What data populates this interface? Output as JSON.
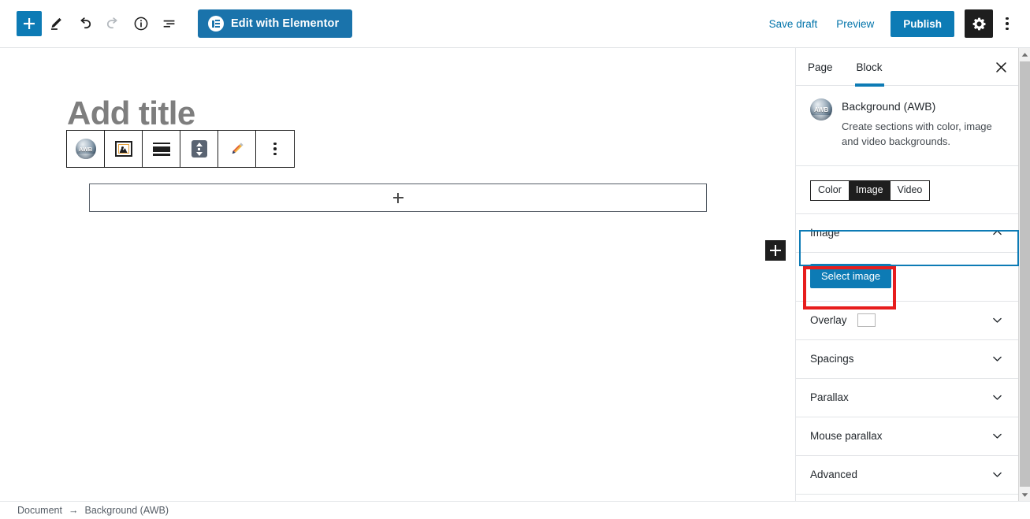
{
  "topbar": {
    "add_block_icon": "plus-icon",
    "edit_icon": "pencil-icon",
    "undo_icon": "undo-arrow-icon",
    "redo_icon": "redo-arrow-icon",
    "info_icon": "info-circle-icon",
    "list_view_icon": "list-view-icon",
    "elementor_label": "Edit with Elementor",
    "elementor_icon": "elementor-logo-icon",
    "save_draft_label": "Save draft",
    "preview_label": "Preview",
    "publish_label": "Publish",
    "settings_icon": "gear-icon",
    "more_icon": "kebab-menu-icon"
  },
  "canvas": {
    "title_placeholder": "Add title",
    "block_toolbar": {
      "items": [
        {
          "name": "awb-block-icon",
          "label": "Background (AWB)"
        },
        {
          "name": "image-icon",
          "label": "Image"
        },
        {
          "name": "align-full-width-icon",
          "label": "Full width"
        },
        {
          "name": "move-vertical-icon",
          "label": "Move up or down"
        },
        {
          "name": "edit-pencil-icon",
          "label": "Edit"
        },
        {
          "name": "block-options-kebab-icon",
          "label": "More options"
        }
      ]
    },
    "empty_block_icon": "plus-icon",
    "floating_inserter_icon": "plus-icon"
  },
  "sidebar": {
    "tabs": [
      {
        "label": "Page",
        "active": false
      },
      {
        "label": "Block",
        "active": true
      }
    ],
    "close_icon": "close-x-icon",
    "block_card": {
      "icon": "awb-sphere-icon",
      "icon_text": "AWB",
      "title": "Background (AWB)",
      "description": "Create sections with color, image and video backgrounds."
    },
    "background_type": {
      "options": [
        {
          "label": "Color",
          "active": false
        },
        {
          "label": "Image",
          "active": true
        },
        {
          "label": "Video",
          "active": false
        }
      ]
    },
    "image_panel": {
      "label": "Image",
      "chevron": "chevron-up-icon",
      "expanded": true,
      "select_image_label": "Select image",
      "highlight_color": "#e71d1d",
      "panel_outline_color": "#0d7bb5"
    },
    "sections": [
      {
        "label": "Overlay",
        "chevron": "chevron-down-icon",
        "has_swatch": true,
        "swatch_color": "#ffffff"
      },
      {
        "label": "Spacings",
        "chevron": "chevron-down-icon",
        "has_swatch": false
      },
      {
        "label": "Parallax",
        "chevron": "chevron-down-icon",
        "has_swatch": false
      },
      {
        "label": "Mouse parallax",
        "chevron": "chevron-down-icon",
        "has_swatch": false
      },
      {
        "label": "Advanced",
        "chevron": "chevron-down-icon",
        "has_swatch": false
      }
    ],
    "scrollbar": {
      "up_icon": "scroll-up-arrow-icon",
      "down_icon": "scroll-down-arrow-icon"
    }
  },
  "statusbar": {
    "document_label": "Document",
    "separator": "→",
    "block_label": "Background (AWB)"
  },
  "colors": {
    "accent_blue": "#0d7bb5",
    "elementor_blue": "#1a73ab",
    "link_blue": "#0073aa",
    "dark": "#1e1e1e",
    "highlight_red": "#e71d1d"
  }
}
